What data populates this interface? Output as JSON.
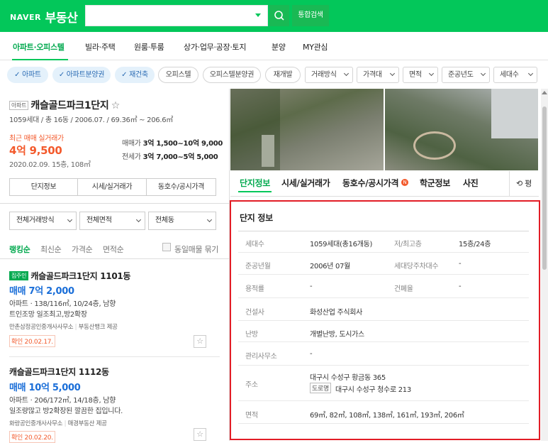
{
  "header": {
    "logo_naver": "NAVER",
    "logo_title": "부동산",
    "integrated_search": "통합검색"
  },
  "nav": {
    "items": [
      "아파트·오피스텔",
      "빌라·주택",
      "원룸·투룸",
      "상가·업무·공장·토지",
      "분양",
      "MY관심"
    ]
  },
  "filters": {
    "chips": [
      {
        "label": "아파트",
        "on": true
      },
      {
        "label": "아파트분양권",
        "on": true
      },
      {
        "label": "재건축",
        "on": true
      },
      {
        "label": "오피스텔",
        "on": false
      },
      {
        "label": "오피스텔분양권",
        "on": false
      },
      {
        "label": "재개발",
        "on": false
      }
    ],
    "dropdowns": [
      "거래방식",
      "가격대",
      "면적",
      "준공년도",
      "세대수"
    ]
  },
  "complex": {
    "type_tag": "아파트",
    "name": "캐슬골드파크1단지",
    "star": "☆",
    "summary": "1059세대 / 총 16동 / 2006.07. / 69.36㎡ ~ 206.6㎡",
    "recent_label": "최근 매매 실거래가",
    "recent_price": "4억 9,500",
    "recent_detail": "2020.02.09. 15층, 108㎡",
    "sale_label": "매매가",
    "sale_range": "3억 1,500~10억 9,000",
    "jeonse_label": "전세가",
    "jeonse_range": "3억 7,000~5억 5,000",
    "buttons": [
      "단지정보",
      "시세/실거래가",
      "동호수/공시가격"
    ]
  },
  "list_filters": {
    "dropdowns": [
      "전체거래방식",
      "전체면적",
      "전체동"
    ],
    "sorts": [
      "랭킹순",
      "최신순",
      "가격순",
      "면적순"
    ],
    "same_group": "동일매물 묶기"
  },
  "listings": [
    {
      "badge": "집주인",
      "title": "캐슬골드파크1단지 1101동",
      "price": "매매 7억 2,000",
      "info": "아파트 · 138/116㎡, 10/24층, 남향",
      "desc": "트인조망 일조최고,방2확장",
      "agent": "만촌삼정공인중개사사무소",
      "provider": "부동산뱅크 제공",
      "confirm": "확인 20.02.17."
    },
    {
      "badge": "",
      "title": "캐슬골드파크1단지 1112동",
      "price": "매매 10억 5,000",
      "info": "아파트 · 206/172㎡, 14/18층, 남향",
      "desc": "일조량많고 방2확장된 깔끔한 집입니다.",
      "agent": "화랑공인중개사사무소",
      "provider": "매경부동산 제공",
      "confirm": "확인 20.02.20."
    }
  ],
  "tabs": [
    "단지정보",
    "시세/실거래가",
    "동호수/공시가격",
    "학군정보",
    "사진"
  ],
  "tab_new": "N",
  "tab_extra": "평",
  "info": {
    "title": "단지 정보",
    "rows": [
      {
        "l1": "세대수",
        "v1": "1059세대(총16개동)",
        "l2": "저/최고층",
        "v2": "15층/24층"
      },
      {
        "l1": "준공년월",
        "v1": "2006년 07월",
        "l2": "세대당주차대수",
        "v2": "-"
      },
      {
        "l1": "용적률",
        "v1": "-",
        "l2": "건폐율",
        "v2": "-"
      },
      {
        "l1": "건설사",
        "v1": "화성산업 주식회사"
      },
      {
        "l1": "난방",
        "v1": "개별난방, 도시가스"
      },
      {
        "l1": "관리사무소",
        "v1": "-"
      },
      {
        "l1": "주소",
        "v1": "대구시 수성구 황금동 365",
        "road_tag": "도로명",
        "v1b": "대구시 수성구 청수로 213"
      },
      {
        "l1": "면적",
        "v1": "69㎡, 82㎡, 108㎡, 138㎡, 161㎡, 193㎡, 206㎡"
      }
    ]
  },
  "colors": {
    "green": "#03c75a",
    "price_red": "#f35a2c",
    "price_blue": "#1a6ed8",
    "chip_blue": "#2a6bb3",
    "highlight": "#e21d26"
  }
}
